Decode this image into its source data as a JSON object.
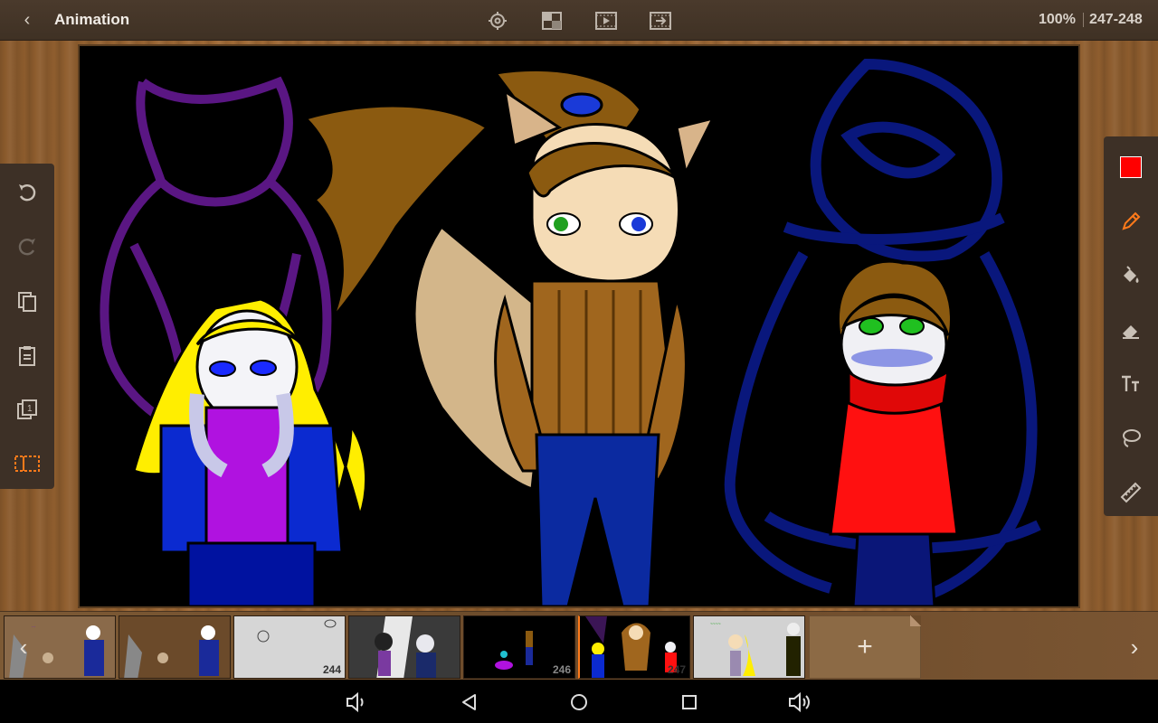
{
  "header": {
    "back_label": "‹",
    "title": "Animation",
    "tools": [
      "settings-icon",
      "layers-icon",
      "play-icon",
      "export-icon"
    ],
    "zoom": "100%",
    "frame_range": "247-248"
  },
  "left_panel": {
    "tools": [
      "undo-icon",
      "redo-icon",
      "copy-icon",
      "paste-icon",
      "onion-skin-icon",
      "frame-list-icon"
    ]
  },
  "right_panel": {
    "current_color": "#ff0000",
    "tools": [
      "pencil-icon",
      "fill-icon",
      "eraser-icon",
      "text-icon",
      "lasso-icon",
      "ruler-icon"
    ]
  },
  "timeline": {
    "frames": [
      {
        "number": ""
      },
      {
        "number": ""
      },
      {
        "number": "244"
      },
      {
        "number": ""
      },
      {
        "number": "246"
      },
      {
        "number": "247"
      },
      {
        "number": ""
      }
    ],
    "add_label": "+",
    "prev_label": "‹",
    "next_label": "›"
  },
  "colors": {
    "accent": "#ff7a1a",
    "toolbar_bg": "#3d3026",
    "wood": "#9a6633"
  }
}
